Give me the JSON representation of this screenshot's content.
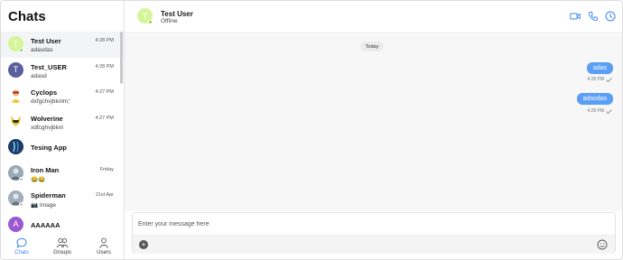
{
  "sidebar": {
    "title": "Chats",
    "chats": [
      {
        "name": "Test User",
        "preview": "adasdas",
        "time": "4:28 PM",
        "initial": "T",
        "avatar_color": "#d5f59a",
        "online": true,
        "active": true
      },
      {
        "name": "Test_USER",
        "preview": "adasd",
        "time": "4:28 PM",
        "initial": "T",
        "avatar_color": "#5b5f9e",
        "online": false
      },
      {
        "name": "Cyclops",
        "preview": "dxfgchvjbknlm;'",
        "time": "4:27 PM",
        "initial": "",
        "avatar_color": "#e8c07a",
        "online": false
      },
      {
        "name": "Wolverine",
        "preview": "xdfcghvjbknl",
        "time": "4:27 PM",
        "initial": "",
        "avatar_color": "#f2c531",
        "online": false
      },
      {
        "name": "Tesing App",
        "preview": "",
        "time": "",
        "initial": "",
        "avatar_color": "#1f3b66",
        "online": false
      },
      {
        "name": "Iron Man",
        "preview": "😂😂",
        "time": "Friday",
        "initial": "",
        "avatar_color": "#8a9aaa",
        "online": false
      },
      {
        "name": "Spiderman",
        "preview": "📷 Image",
        "time": "21st Apr",
        "initial": "",
        "avatar_color": "#9aa4b0",
        "online": false
      },
      {
        "name": "AAAAAA",
        "preview": "",
        "time": "",
        "initial": "A",
        "avatar_color": "#9b59d0",
        "online": false
      }
    ]
  },
  "nav": {
    "chats_label": "Chats",
    "groups_label": "Groups",
    "users_label": "Users",
    "accent": "#3b82f6"
  },
  "header": {
    "name": "Test User",
    "status": "Offline",
    "initial": "T",
    "icons": [
      "video-icon",
      "phone-icon",
      "info-icon"
    ]
  },
  "conversation": {
    "date_label": "Today",
    "messages": [
      {
        "text": "adas",
        "time": "4:28 PM"
      },
      {
        "text": "adasdas",
        "time": "4:28 PM"
      }
    ],
    "bubble_color": "#5b9ef5"
  },
  "composer": {
    "placeholder": "Enter your message here",
    "plus": "+"
  }
}
